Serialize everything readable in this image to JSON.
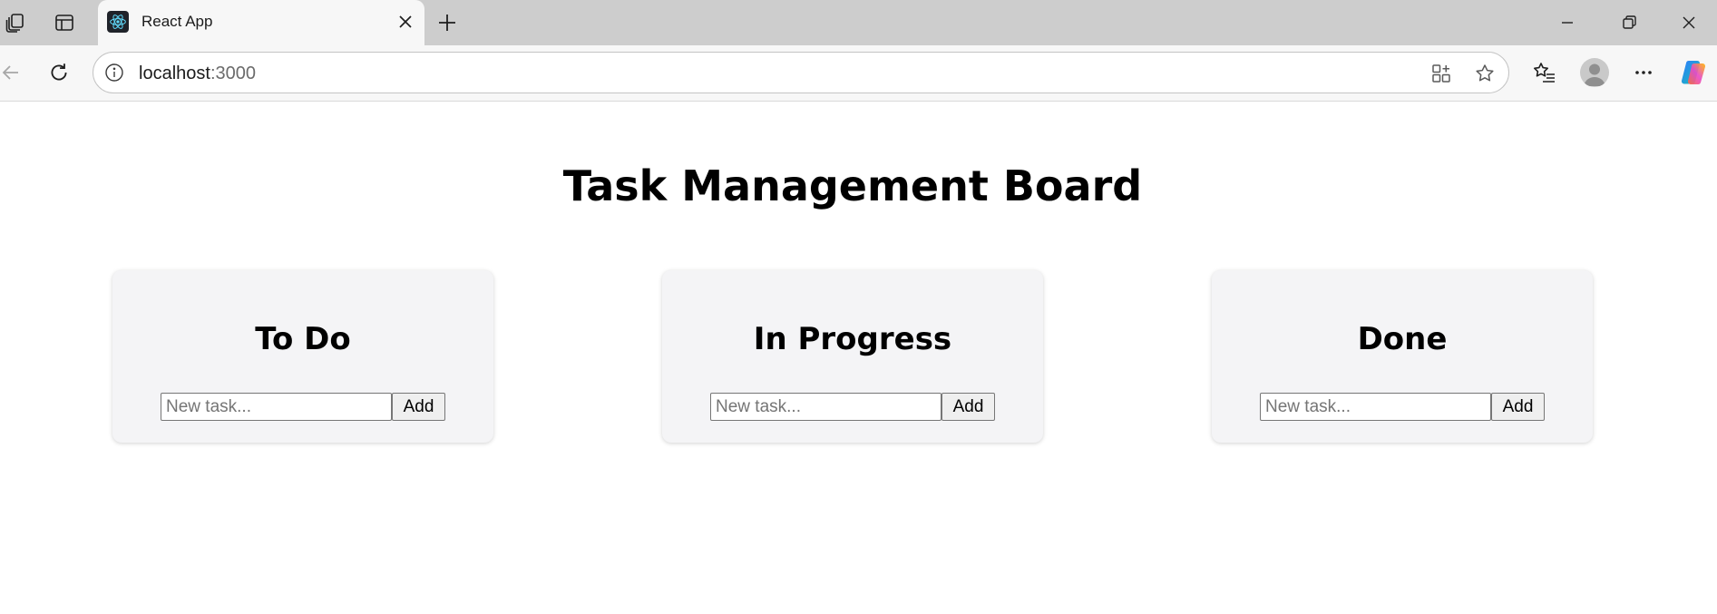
{
  "browser": {
    "tab": {
      "title": "React App"
    },
    "address": {
      "host": "localhost",
      "port": ":3000"
    },
    "icons": {
      "workspaces": "workspaces-icon",
      "tab_actions": "tab-actions-icon",
      "favicon": "react-icon",
      "close": "close-icon",
      "new_tab": "plus-icon",
      "minimize": "minimize-icon",
      "restore": "restore-icon",
      "window_close": "close-icon",
      "back": "back-arrow-icon",
      "refresh": "refresh-icon",
      "site_info": "info-icon",
      "apps": "app-available-icon",
      "favorite": "star-icon",
      "favorites": "favorites-icon",
      "profile": "profile-icon",
      "more": "more-icon",
      "copilot": "copilot-icon"
    }
  },
  "page": {
    "title": "Task Management Board",
    "columns": [
      {
        "title": "To Do",
        "input_placeholder": "New task...",
        "input_value": "",
        "button_label": "Add"
      },
      {
        "title": "In Progress",
        "input_placeholder": "New task...",
        "input_value": "",
        "button_label": "Add"
      },
      {
        "title": "Done",
        "input_placeholder": "New task...",
        "input_value": "",
        "button_label": "Add"
      }
    ]
  },
  "colors": {
    "tabstrip_bg": "#cdcdcd",
    "toolbar_bg": "#f7f7f7",
    "column_bg": "#f4f4f6",
    "react_blue": "#61dafb"
  }
}
